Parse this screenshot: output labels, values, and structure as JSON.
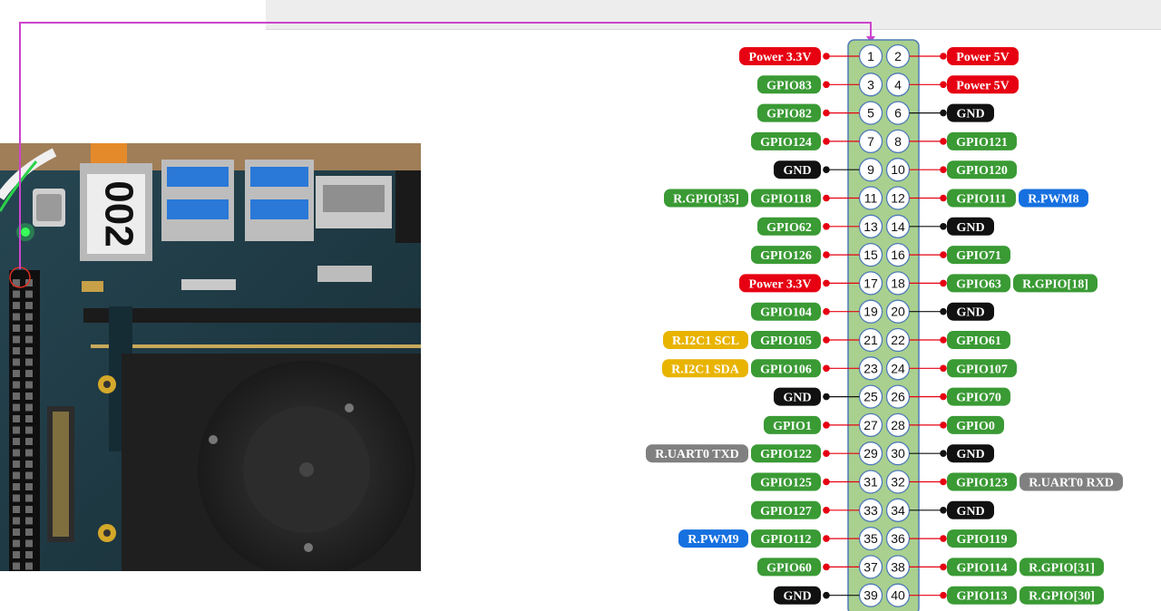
{
  "colors": {
    "power": "#e60012",
    "gpio": "#3a9a34",
    "gnd": "#111111",
    "pwm": "#1670e0",
    "i2c": "#e8b400",
    "uart": "#808080",
    "header_fill": "#a9d08e",
    "connector_line": "#cc44cc"
  },
  "board_photo": {
    "label": "002"
  },
  "pins": [
    {
      "left_num": "1",
      "right_num": "2",
      "left": [
        {
          "text": "Power 3.3V",
          "type": "power"
        }
      ],
      "right": [
        {
          "text": "Power 5V",
          "type": "power"
        }
      ]
    },
    {
      "left_num": "3",
      "right_num": "4",
      "left": [
        {
          "text": "GPIO83",
          "type": "gpio"
        }
      ],
      "right": [
        {
          "text": "Power 5V",
          "type": "power"
        }
      ]
    },
    {
      "left_num": "5",
      "right_num": "6",
      "left": [
        {
          "text": "GPIO82",
          "type": "gpio"
        }
      ],
      "right": [
        {
          "text": "GND",
          "type": "gnd"
        }
      ]
    },
    {
      "left_num": "7",
      "right_num": "8",
      "left": [
        {
          "text": "GPIO124",
          "type": "gpio"
        }
      ],
      "right": [
        {
          "text": "GPIO121",
          "type": "gpio"
        }
      ]
    },
    {
      "left_num": "9",
      "right_num": "10",
      "left": [
        {
          "text": "GND",
          "type": "gnd"
        }
      ],
      "right": [
        {
          "text": "GPIO120",
          "type": "gpio"
        }
      ]
    },
    {
      "left_num": "11",
      "right_num": "12",
      "left": [
        {
          "text": "GPIO118",
          "type": "gpio"
        },
        {
          "text": "R.GPIO[35]",
          "type": "gpio"
        }
      ],
      "right": [
        {
          "text": "GPIO111",
          "type": "gpio"
        },
        {
          "text": "R.PWM8",
          "type": "pwm"
        }
      ]
    },
    {
      "left_num": "13",
      "right_num": "14",
      "left": [
        {
          "text": "GPIO62",
          "type": "gpio"
        }
      ],
      "right": [
        {
          "text": "GND",
          "type": "gnd"
        }
      ]
    },
    {
      "left_num": "15",
      "right_num": "16",
      "left": [
        {
          "text": "GPIO126",
          "type": "gpio"
        }
      ],
      "right": [
        {
          "text": "GPIO71",
          "type": "gpio"
        }
      ]
    },
    {
      "left_num": "17",
      "right_num": "18",
      "left": [
        {
          "text": "Power 3.3V",
          "type": "power"
        }
      ],
      "right": [
        {
          "text": "GPIO63",
          "type": "gpio"
        },
        {
          "text": "R.GPIO[18]",
          "type": "gpio"
        }
      ]
    },
    {
      "left_num": "19",
      "right_num": "20",
      "left": [
        {
          "text": "GPIO104",
          "type": "gpio"
        }
      ],
      "right": [
        {
          "text": "GND",
          "type": "gnd"
        }
      ]
    },
    {
      "left_num": "21",
      "right_num": "22",
      "left": [
        {
          "text": "GPIO105",
          "type": "gpio"
        },
        {
          "text": "R.I2C1 SCL",
          "type": "i2c"
        }
      ],
      "right": [
        {
          "text": "GPIO61",
          "type": "gpio"
        }
      ]
    },
    {
      "left_num": "23",
      "right_num": "24",
      "left": [
        {
          "text": "GPIO106",
          "type": "gpio"
        },
        {
          "text": "R.I2C1 SDA",
          "type": "i2c"
        }
      ],
      "right": [
        {
          "text": "GPIO107",
          "type": "gpio"
        }
      ]
    },
    {
      "left_num": "25",
      "right_num": "26",
      "left": [
        {
          "text": "GND",
          "type": "gnd"
        }
      ],
      "right": [
        {
          "text": "GPIO70",
          "type": "gpio"
        }
      ]
    },
    {
      "left_num": "27",
      "right_num": "28",
      "left": [
        {
          "text": "GPIO1",
          "type": "gpio"
        }
      ],
      "right": [
        {
          "text": "GPIO0",
          "type": "gpio"
        }
      ]
    },
    {
      "left_num": "29",
      "right_num": "30",
      "left": [
        {
          "text": "GPIO122",
          "type": "gpio"
        },
        {
          "text": "R.UART0 TXD",
          "type": "uart"
        }
      ],
      "right": [
        {
          "text": "GND",
          "type": "gnd"
        }
      ]
    },
    {
      "left_num": "31",
      "right_num": "32",
      "left": [
        {
          "text": "GPIO125",
          "type": "gpio"
        }
      ],
      "right": [
        {
          "text": "GPIO123",
          "type": "gpio"
        },
        {
          "text": "R.UART0 RXD",
          "type": "uart"
        }
      ]
    },
    {
      "left_num": "33",
      "right_num": "34",
      "left": [
        {
          "text": "GPIO127",
          "type": "gpio"
        }
      ],
      "right": [
        {
          "text": "GND",
          "type": "gnd"
        }
      ]
    },
    {
      "left_num": "35",
      "right_num": "36",
      "left": [
        {
          "text": "GPIO112",
          "type": "gpio"
        },
        {
          "text": "R.PWM9",
          "type": "pwm"
        }
      ],
      "right": [
        {
          "text": "GPIO119",
          "type": "gpio"
        }
      ]
    },
    {
      "left_num": "37",
      "right_num": "38",
      "left": [
        {
          "text": "GPIO60",
          "type": "gpio"
        }
      ],
      "right": [
        {
          "text": "GPIO114",
          "type": "gpio"
        },
        {
          "text": "R.GPIO[31]",
          "type": "gpio"
        }
      ]
    },
    {
      "left_num": "39",
      "right_num": "40",
      "left": [
        {
          "text": "GND",
          "type": "gnd"
        }
      ],
      "right": [
        {
          "text": "GPIO113",
          "type": "gpio"
        },
        {
          "text": "R.GPIO[30]",
          "type": "gpio"
        }
      ]
    }
  ]
}
